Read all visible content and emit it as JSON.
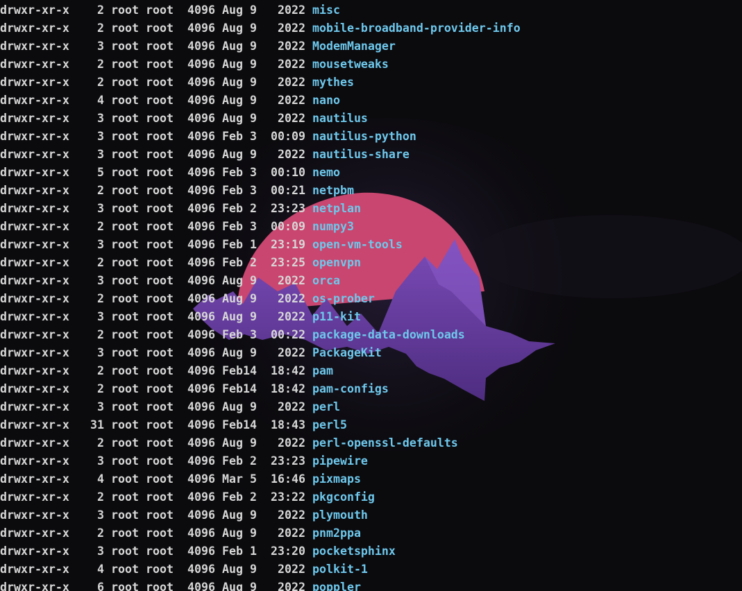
{
  "theme": {
    "background": "#0b0a0d",
    "text_color": "#d7d7d7",
    "directory_color": "#6ec8ec",
    "sun_color": "#c8466f",
    "mountain_color": "#6a3fa2"
  },
  "entries": [
    {
      "perm": "drwxr-xr-x",
      "links": "2",
      "owner": "root",
      "group": "root",
      "size": "4096",
      "month": "Aug",
      "day": "9",
      "time": "2022",
      "name": "misc"
    },
    {
      "perm": "drwxr-xr-x",
      "links": "2",
      "owner": "root",
      "group": "root",
      "size": "4096",
      "month": "Aug",
      "day": "9",
      "time": "2022",
      "name": "mobile-broadband-provider-info"
    },
    {
      "perm": "drwxr-xr-x",
      "links": "3",
      "owner": "root",
      "group": "root",
      "size": "4096",
      "month": "Aug",
      "day": "9",
      "time": "2022",
      "name": "ModemManager"
    },
    {
      "perm": "drwxr-xr-x",
      "links": "2",
      "owner": "root",
      "group": "root",
      "size": "4096",
      "month": "Aug",
      "day": "9",
      "time": "2022",
      "name": "mousetweaks"
    },
    {
      "perm": "drwxr-xr-x",
      "links": "2",
      "owner": "root",
      "group": "root",
      "size": "4096",
      "month": "Aug",
      "day": "9",
      "time": "2022",
      "name": "mythes"
    },
    {
      "perm": "drwxr-xr-x",
      "links": "4",
      "owner": "root",
      "group": "root",
      "size": "4096",
      "month": "Aug",
      "day": "9",
      "time": "2022",
      "name": "nano"
    },
    {
      "perm": "drwxr-xr-x",
      "links": "3",
      "owner": "root",
      "group": "root",
      "size": "4096",
      "month": "Aug",
      "day": "9",
      "time": "2022",
      "name": "nautilus"
    },
    {
      "perm": "drwxr-xr-x",
      "links": "3",
      "owner": "root",
      "group": "root",
      "size": "4096",
      "month": "Feb",
      "day": "3",
      "time": "00:09",
      "name": "nautilus-python"
    },
    {
      "perm": "drwxr-xr-x",
      "links": "3",
      "owner": "root",
      "group": "root",
      "size": "4096",
      "month": "Aug",
      "day": "9",
      "time": "2022",
      "name": "nautilus-share"
    },
    {
      "perm": "drwxr-xr-x",
      "links": "5",
      "owner": "root",
      "group": "root",
      "size": "4096",
      "month": "Feb",
      "day": "3",
      "time": "00:10",
      "name": "nemo"
    },
    {
      "perm": "drwxr-xr-x",
      "links": "2",
      "owner": "root",
      "group": "root",
      "size": "4096",
      "month": "Feb",
      "day": "3",
      "time": "00:21",
      "name": "netpbm"
    },
    {
      "perm": "drwxr-xr-x",
      "links": "3",
      "owner": "root",
      "group": "root",
      "size": "4096",
      "month": "Feb",
      "day": "2",
      "time": "23:23",
      "name": "netplan"
    },
    {
      "perm": "drwxr-xr-x",
      "links": "2",
      "owner": "root",
      "group": "root",
      "size": "4096",
      "month": "Feb",
      "day": "3",
      "time": "00:09",
      "name": "numpy3"
    },
    {
      "perm": "drwxr-xr-x",
      "links": "3",
      "owner": "root",
      "group": "root",
      "size": "4096",
      "month": "Feb",
      "day": "1",
      "time": "23:19",
      "name": "open-vm-tools"
    },
    {
      "perm": "drwxr-xr-x",
      "links": "2",
      "owner": "root",
      "group": "root",
      "size": "4096",
      "month": "Feb",
      "day": "2",
      "time": "23:25",
      "name": "openvpn"
    },
    {
      "perm": "drwxr-xr-x",
      "links": "3",
      "owner": "root",
      "group": "root",
      "size": "4096",
      "month": "Aug",
      "day": "9",
      "time": "2022",
      "name": "orca"
    },
    {
      "perm": "drwxr-xr-x",
      "links": "2",
      "owner": "root",
      "group": "root",
      "size": "4096",
      "month": "Aug",
      "day": "9",
      "time": "2022",
      "name": "os-prober"
    },
    {
      "perm": "drwxr-xr-x",
      "links": "3",
      "owner": "root",
      "group": "root",
      "size": "4096",
      "month": "Aug",
      "day": "9",
      "time": "2022",
      "name": "p11-kit"
    },
    {
      "perm": "drwxr-xr-x",
      "links": "2",
      "owner": "root",
      "group": "root",
      "size": "4096",
      "month": "Feb",
      "day": "3",
      "time": "00:22",
      "name": "package-data-downloads"
    },
    {
      "perm": "drwxr-xr-x",
      "links": "3",
      "owner": "root",
      "group": "root",
      "size": "4096",
      "month": "Aug",
      "day": "9",
      "time": "2022",
      "name": "PackageKit"
    },
    {
      "perm": "drwxr-xr-x",
      "links": "2",
      "owner": "root",
      "group": "root",
      "size": "4096",
      "month": "Feb",
      "day": "14",
      "time": "18:42",
      "name": "pam"
    },
    {
      "perm": "drwxr-xr-x",
      "links": "2",
      "owner": "root",
      "group": "root",
      "size": "4096",
      "month": "Feb",
      "day": "14",
      "time": "18:42",
      "name": "pam-configs"
    },
    {
      "perm": "drwxr-xr-x",
      "links": "3",
      "owner": "root",
      "group": "root",
      "size": "4096",
      "month": "Aug",
      "day": "9",
      "time": "2022",
      "name": "perl"
    },
    {
      "perm": "drwxr-xr-x",
      "links": "31",
      "owner": "root",
      "group": "root",
      "size": "4096",
      "month": "Feb",
      "day": "14",
      "time": "18:43",
      "name": "perl5"
    },
    {
      "perm": "drwxr-xr-x",
      "links": "2",
      "owner": "root",
      "group": "root",
      "size": "4096",
      "month": "Aug",
      "day": "9",
      "time": "2022",
      "name": "perl-openssl-defaults"
    },
    {
      "perm": "drwxr-xr-x",
      "links": "3",
      "owner": "root",
      "group": "root",
      "size": "4096",
      "month": "Feb",
      "day": "2",
      "time": "23:23",
      "name": "pipewire"
    },
    {
      "perm": "drwxr-xr-x",
      "links": "4",
      "owner": "root",
      "group": "root",
      "size": "4096",
      "month": "Mar",
      "day": "5",
      "time": "16:46",
      "name": "pixmaps"
    },
    {
      "perm": "drwxr-xr-x",
      "links": "2",
      "owner": "root",
      "group": "root",
      "size": "4096",
      "month": "Feb",
      "day": "2",
      "time": "23:22",
      "name": "pkgconfig"
    },
    {
      "perm": "drwxr-xr-x",
      "links": "3",
      "owner": "root",
      "group": "root",
      "size": "4096",
      "month": "Aug",
      "day": "9",
      "time": "2022",
      "name": "plymouth"
    },
    {
      "perm": "drwxr-xr-x",
      "links": "2",
      "owner": "root",
      "group": "root",
      "size": "4096",
      "month": "Aug",
      "day": "9",
      "time": "2022",
      "name": "pnm2ppa"
    },
    {
      "perm": "drwxr-xr-x",
      "links": "3",
      "owner": "root",
      "group": "root",
      "size": "4096",
      "month": "Feb",
      "day": "1",
      "time": "23:20",
      "name": "pocketsphinx"
    },
    {
      "perm": "drwxr-xr-x",
      "links": "4",
      "owner": "root",
      "group": "root",
      "size": "4096",
      "month": "Aug",
      "day": "9",
      "time": "2022",
      "name": "polkit-1"
    },
    {
      "perm": "drwxr-xr-x",
      "links": "6",
      "owner": "root",
      "group": "root",
      "size": "4096",
      "month": "Aug",
      "day": "9",
      "time": "2022",
      "name": "poppler"
    }
  ]
}
